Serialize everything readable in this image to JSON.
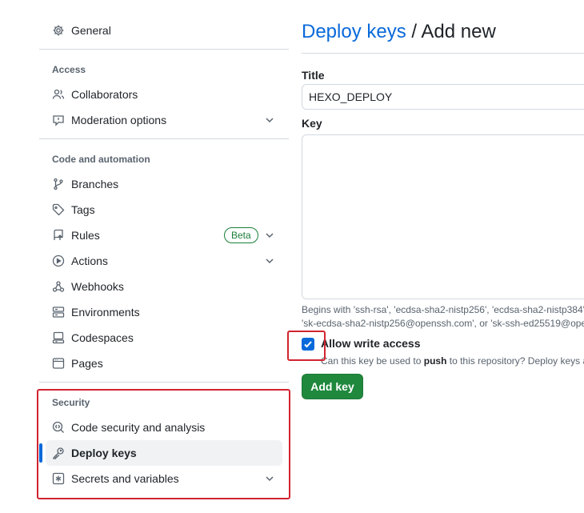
{
  "sidebar": {
    "general": {
      "label": "General",
      "icon": "gear-icon"
    },
    "sections": {
      "access": "Access",
      "code_automation": "Code and automation",
      "security": "Security"
    },
    "access_items": [
      {
        "label": "Collaborators",
        "icon": "people-icon"
      },
      {
        "label": "Moderation options",
        "icon": "comment-report-icon",
        "expandable": true
      }
    ],
    "code_items": [
      {
        "label": "Branches",
        "icon": "git-branch-icon"
      },
      {
        "label": "Tags",
        "icon": "tag-icon"
      },
      {
        "label": "Rules",
        "icon": "repo-push-icon",
        "badge": "Beta",
        "expandable": true
      },
      {
        "label": "Actions",
        "icon": "play-icon",
        "expandable": true
      },
      {
        "label": "Webhooks",
        "icon": "webhook-icon"
      },
      {
        "label": "Environments",
        "icon": "server-icon"
      },
      {
        "label": "Codespaces",
        "icon": "codespaces-icon"
      },
      {
        "label": "Pages",
        "icon": "browser-icon"
      }
    ],
    "security_items": [
      {
        "label": "Code security and analysis",
        "icon": "codescan-icon"
      },
      {
        "label": "Deploy keys",
        "icon": "key-icon",
        "active": true
      },
      {
        "label": "Secrets and variables",
        "icon": "asterisk-icon",
        "expandable": true
      }
    ]
  },
  "main": {
    "title_link": "Deploy keys",
    "title_rest": " / Add new",
    "title_label": "Title",
    "title_value": "HEXO_DEPLOY",
    "key_label": "Key",
    "key_value": "",
    "key_note_line1": "Begins with 'ssh-rsa', 'ecdsa-sha2-nistp256', 'ecdsa-sha2-nistp384',",
    "key_note_line2": "'sk-ecdsa-sha2-nistp256@openssh.com', or 'sk-ssh-ed25519@oper",
    "allow_write_label": "Allow write access",
    "allow_write_checked": true,
    "allow_write_note_pre": "Can this key be used to ",
    "allow_write_note_bold": "push",
    "allow_write_note_post": " to this repository? Deploy keys a",
    "add_button": "Add key"
  },
  "colors": {
    "accent": "#0969da",
    "primary_button": "#1f883d",
    "highlight": "#d1242f",
    "badge": "#1a7f37"
  }
}
